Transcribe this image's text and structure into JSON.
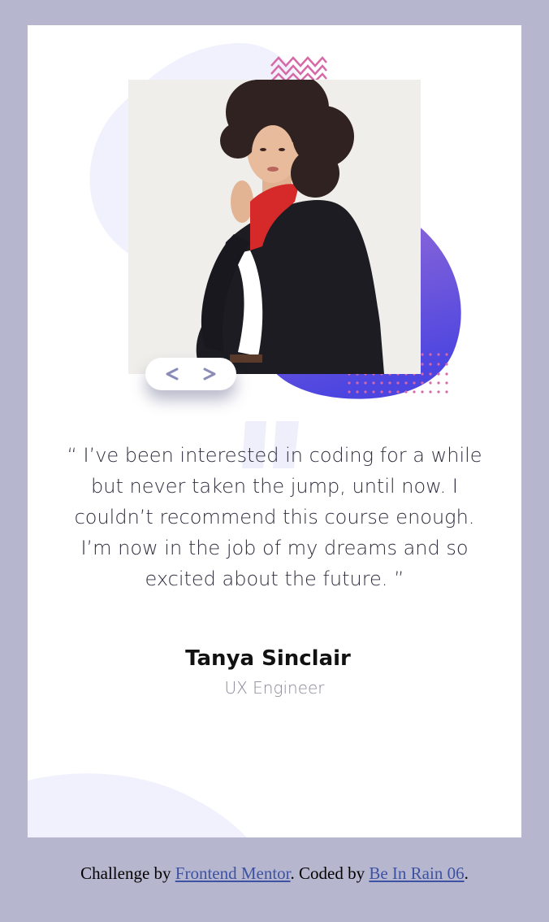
{
  "testimonial": {
    "quote": "“ I’ve been interested in coding for a while but never taken the jump, until now. I couldn’t recommend this course enough. I’m now in the job of my dreams and so excited about the future. ”",
    "name": "Tanya Sinclair",
    "role": "UX Engineer",
    "photo_alt": "Tanya Sinclair"
  },
  "navigation": {
    "prev_icon": "chevron-left-icon",
    "next_icon": "chevron-right-icon"
  },
  "footer": {
    "prefix": "Challenge by ",
    "link1_text": "Frontend Mentor",
    "middle": ". Coded by ",
    "link2_text": "Be In Rain 06",
    "suffix": "."
  },
  "colors": {
    "page_background": "#b6b7cf",
    "card_background": "#ffffff",
    "accent_purple": "#6a57d6",
    "accent_pink": "#d66aa8",
    "nav_arrow": "#8b8bb8"
  }
}
